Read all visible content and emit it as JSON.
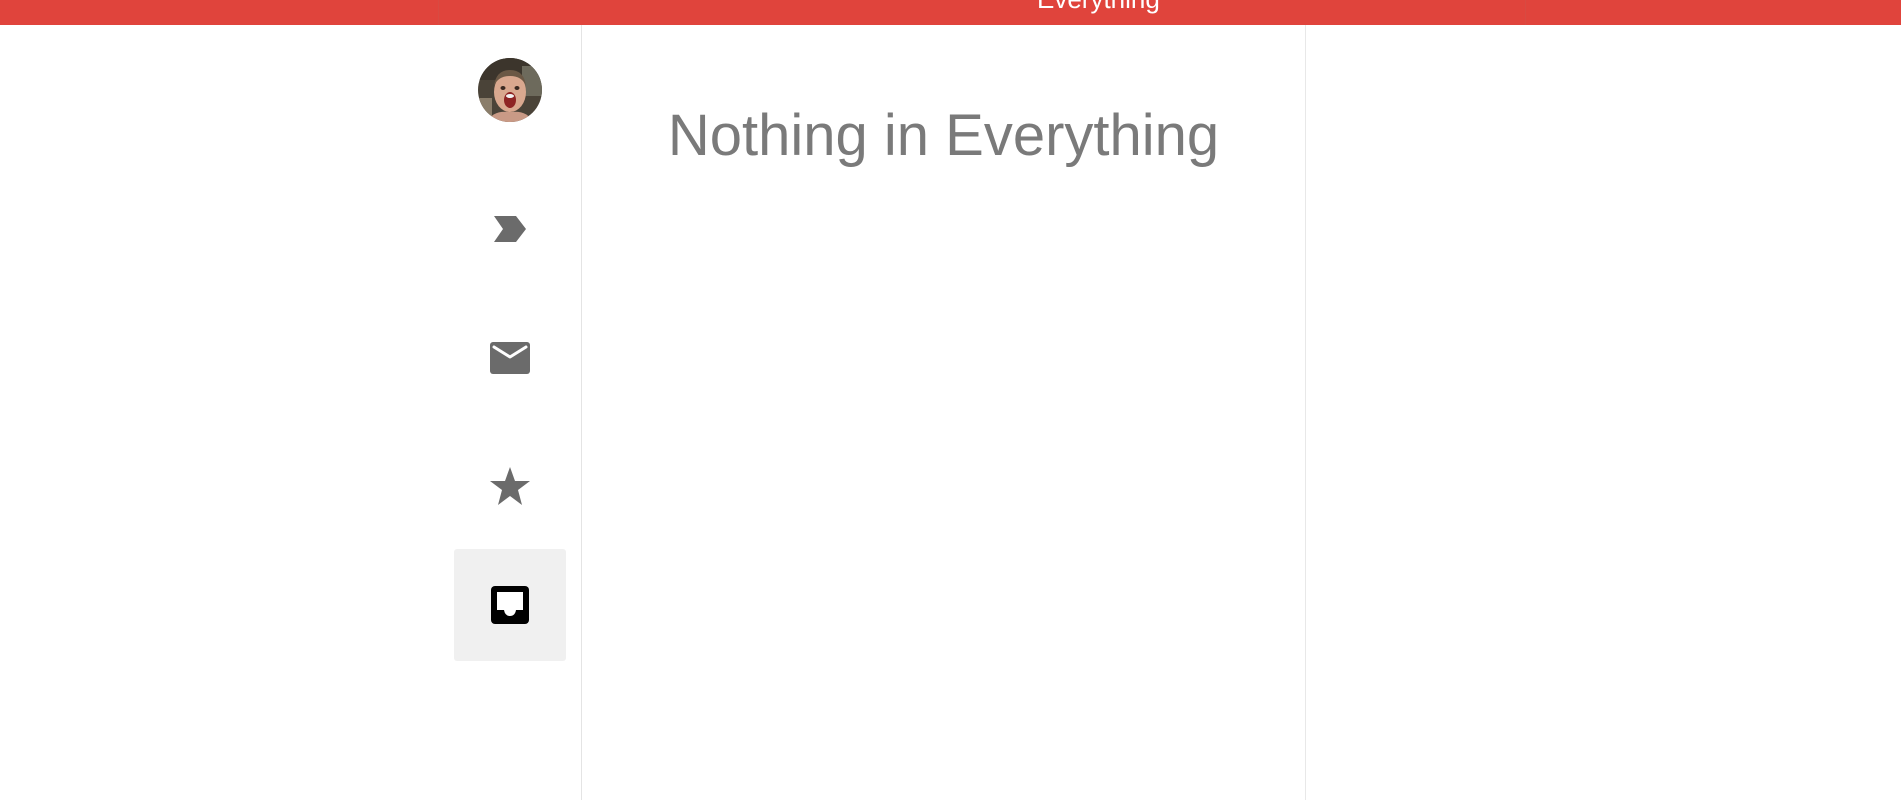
{
  "header": {
    "title": "Everything",
    "background_color": "#e0443c"
  },
  "sidebar": {
    "avatar": {
      "name": "user-avatar"
    },
    "items": [
      {
        "icon": "chevron-label-icon",
        "active": false
      },
      {
        "icon": "envelope-icon",
        "active": false
      },
      {
        "icon": "star-icon",
        "active": false
      },
      {
        "icon": "inbox-icon",
        "active": true
      }
    ],
    "active_background": "#f0f0f0",
    "icon_color": "#6b6b6b",
    "active_icon_color": "#000000"
  },
  "main": {
    "empty_message": "Nothing in Everything"
  }
}
